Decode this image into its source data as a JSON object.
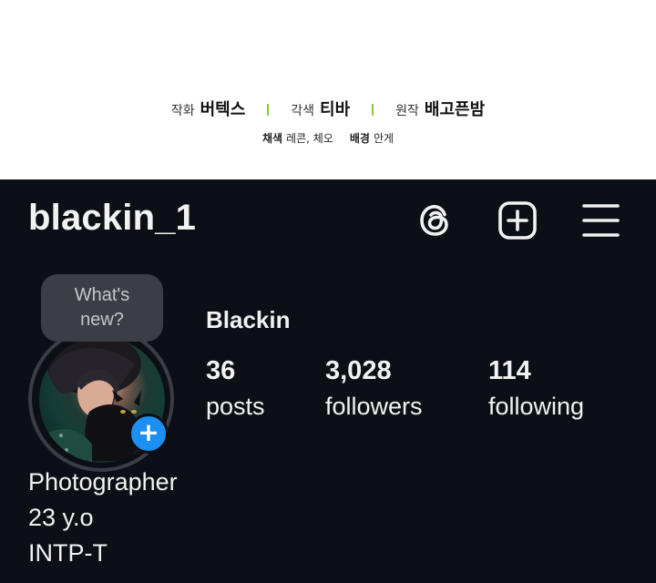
{
  "credits": {
    "row1": [
      {
        "role": "작화",
        "name": "버텍스"
      },
      {
        "role": "각색",
        "name": "티바"
      },
      {
        "role": "원작",
        "name": "배고픈밤"
      }
    ],
    "row2": [
      {
        "role": "채색",
        "name": "레콘, 체오"
      },
      {
        "role": "배경",
        "name": "안게"
      }
    ],
    "separator_color": "#8cc63f"
  },
  "profile": {
    "username": "blackin_1",
    "icons": [
      "threads-icon",
      "create-post-icon",
      "hamburger-menu-icon"
    ],
    "whats_new": {
      "line1": "What's",
      "line2": "new?"
    },
    "add_story_label": "+",
    "display_name": "Blackin",
    "stats": {
      "posts": {
        "value": "36",
        "label": "posts"
      },
      "followers": {
        "value": "3,028",
        "label": "followers"
      },
      "following": {
        "value": "114",
        "label": "following"
      }
    },
    "bio": [
      "Photographer",
      "23 y.o",
      "INTP-T"
    ],
    "colors": {
      "background": "#0c0f15",
      "accent": "#1b8ff2",
      "bubble": "#3b3e45"
    }
  }
}
